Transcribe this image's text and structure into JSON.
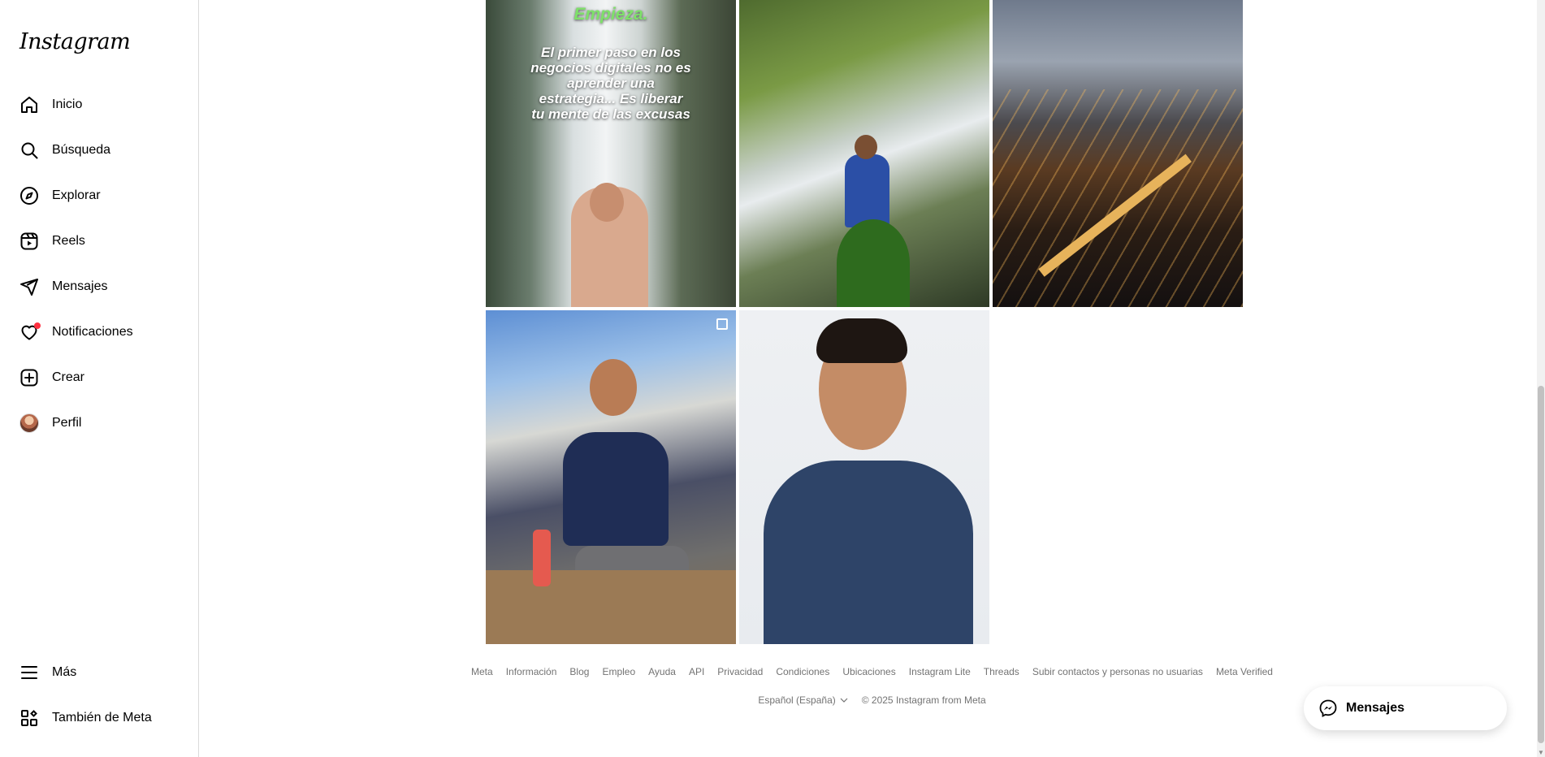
{
  "app": {
    "logo": "Instagram"
  },
  "sidebar": {
    "items": [
      {
        "label": "Inicio",
        "icon": "home-icon"
      },
      {
        "label": "Búsqueda",
        "icon": "search-icon"
      },
      {
        "label": "Explorar",
        "icon": "compass-icon"
      },
      {
        "label": "Reels",
        "icon": "reels-icon"
      },
      {
        "label": "Mensajes",
        "icon": "paper-plane-icon"
      },
      {
        "label": "Notificaciones",
        "icon": "heart-icon"
      },
      {
        "label": "Crear",
        "icon": "plus-square-icon"
      },
      {
        "label": "Perfil",
        "icon": "avatar"
      }
    ],
    "more": {
      "label": "Más",
      "icon": "menu-icon"
    },
    "meta": {
      "label": "También de Meta",
      "icon": "grid-icon"
    }
  },
  "posts": [
    {
      "overlay_green": "Empieza.",
      "overlay_white": [
        "El primer paso en los",
        "negocios digitales no es",
        "aprender una",
        "estrategia... Es liberar",
        "tu mente de las excusas"
      ]
    }
  ],
  "footer": {
    "links": [
      "Meta",
      "Información",
      "Blog",
      "Empleo",
      "Ayuda",
      "API",
      "Privacidad",
      "Condiciones",
      "Ubicaciones",
      "Instagram Lite",
      "Threads",
      "Subir contactos y personas no usuarias",
      "Meta Verified"
    ],
    "language": "Español (España)",
    "copyright": "© 2025 Instagram from Meta"
  },
  "messages_bubble": {
    "label": "Mensajes"
  },
  "colors": {
    "notification_dot": "#ff3040",
    "footer_text": "#737373",
    "border": "#dbdbdb"
  }
}
